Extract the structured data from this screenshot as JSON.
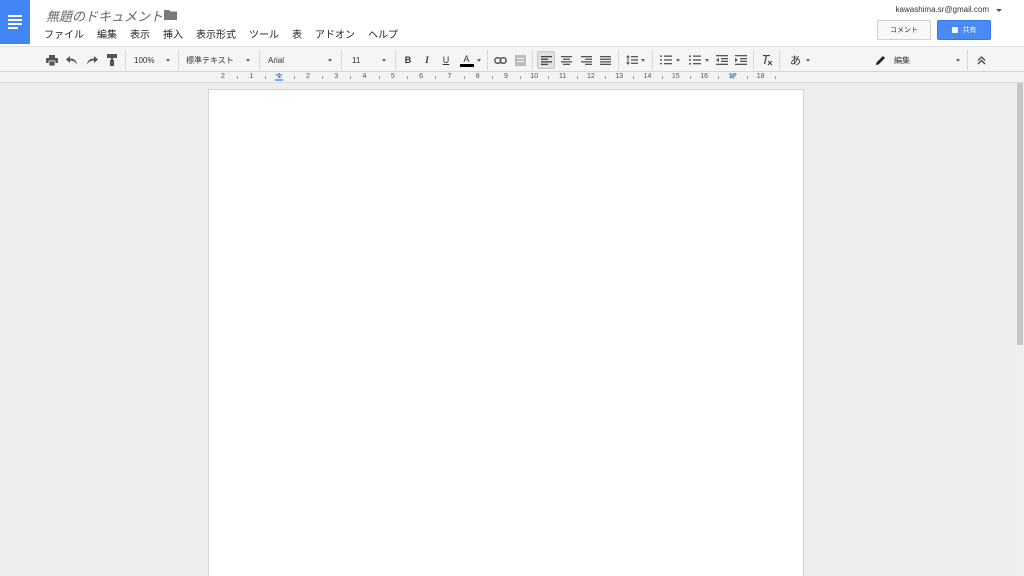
{
  "header": {
    "doc_title": "無題のドキュメント",
    "account_email": "kawashima.sr@gmail.com",
    "comment_label": "コメント",
    "share_label": "共有"
  },
  "menu": [
    "ファイル",
    "編集",
    "表示",
    "挿入",
    "表示形式",
    "ツール",
    "表",
    "アドオン",
    "ヘルプ"
  ],
  "toolbar": {
    "zoom": "100%",
    "style": "標準テキスト",
    "font": "Arial",
    "font_size": "11",
    "bold": "B",
    "italic": "I",
    "underline": "U",
    "text_color": "A",
    "input_tool": "あ",
    "mode": "編集"
  },
  "ruler": {
    "labels": [
      "2",
      "1",
      "1",
      "2",
      "3",
      "4",
      "5",
      "6",
      "7",
      "8",
      "9",
      "10",
      "11",
      "12",
      "13",
      "14",
      "15",
      "16",
      "17",
      "18"
    ]
  },
  "colors": {
    "accent": "#4285f4",
    "share_bg": "#4a8af4"
  },
  "icons": {
    "app": "docs-menu-icon",
    "folder": "folder-icon",
    "print": "print-icon",
    "undo": "undo-icon",
    "redo": "redo-icon",
    "paint_format": "paint-format-icon",
    "link": "link-icon",
    "comment": "insert-comment-icon",
    "clear_format": "clear-formatting-icon",
    "pencil": "pencil-icon",
    "collapse": "collapse-toolbar-icon"
  }
}
